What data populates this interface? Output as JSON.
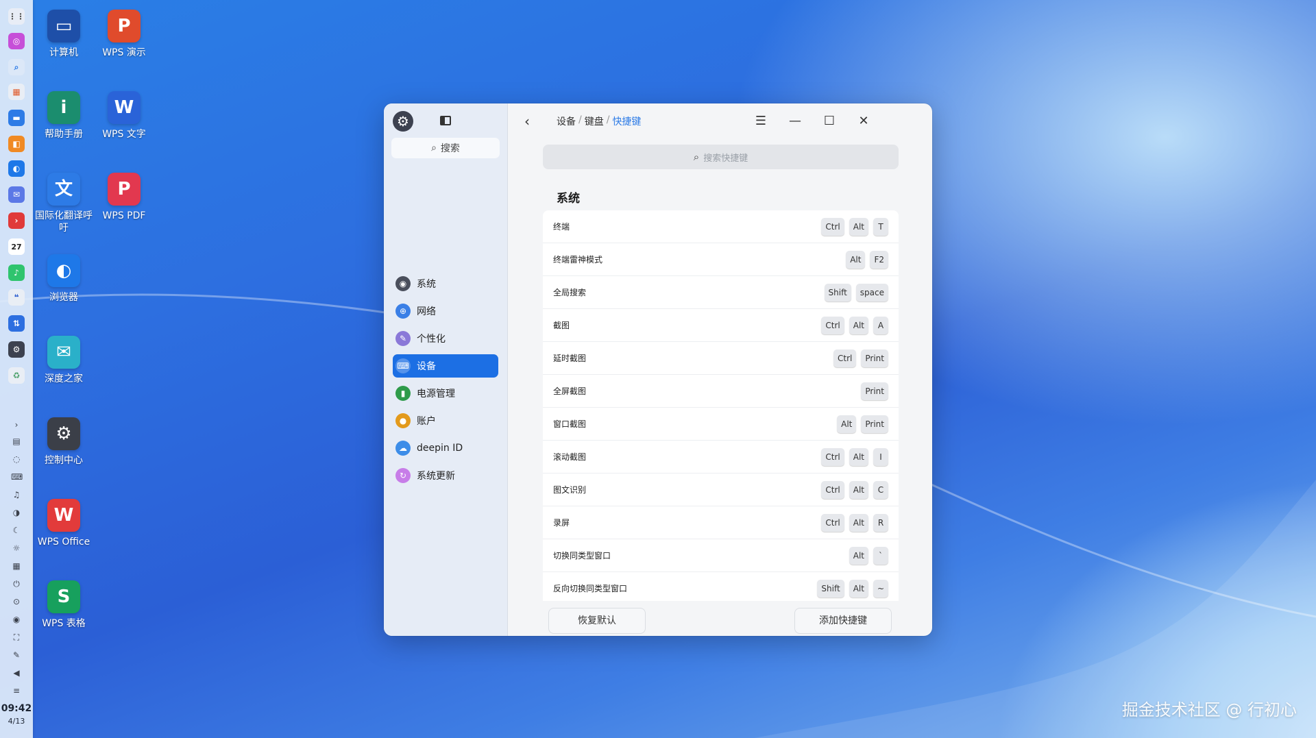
{
  "desktop": {
    "icons": [
      {
        "label": "计算机",
        "glyph": "▭",
        "icon": "computer-icon",
        "color": "#1e4fa8"
      },
      {
        "label": "WPS 演示",
        "glyph": "P",
        "icon": "wps-presentation-icon",
        "color": "#e04b2c"
      },
      {
        "label": "帮助手册",
        "glyph": "i",
        "icon": "help-manual-icon",
        "color": "#1b8d6e"
      },
      {
        "label": "WPS 文字",
        "glyph": "W",
        "icon": "wps-writer-icon",
        "color": "#2a63d8"
      },
      {
        "label": "国际化翻译呼吁",
        "glyph": "文",
        "icon": "translate-icon",
        "color": "#2d7be6"
      },
      {
        "label": "WPS PDF",
        "glyph": "P",
        "icon": "wps-pdf-icon",
        "color": "#e2384f"
      },
      {
        "label": "浏览器",
        "glyph": "◐",
        "icon": "browser-icon",
        "color": "#1e78e8"
      },
      {
        "label": "深度之家",
        "glyph": "✉",
        "icon": "deepin-home-icon",
        "color": "#2ab0c9"
      },
      {
        "label": "控制中心",
        "glyph": "⚙",
        "icon": "control-center-icon",
        "color": "#3b3f48"
      },
      {
        "label": "WPS Office",
        "glyph": "W",
        "icon": "wps-office-icon",
        "color": "#e23b3b"
      },
      {
        "label": "WPS 表格",
        "glyph": "S",
        "icon": "wps-spreadsheet-icon",
        "color": "#17a05d"
      }
    ]
  },
  "dock": {
    "time": "09:42",
    "date": "4/13",
    "calendar_day": "27"
  },
  "window": {
    "sidebar": {
      "search_label": "搜索",
      "items": [
        {
          "label": "系统",
          "icon": "system-icon",
          "color": "#4a4f5c",
          "glyph": "◉"
        },
        {
          "label": "网络",
          "icon": "network-icon",
          "color": "#3a7fe6",
          "glyph": "⊕"
        },
        {
          "label": "个性化",
          "icon": "personalization-icon",
          "color": "#8a78d8",
          "glyph": "✎"
        },
        {
          "label": "设备",
          "icon": "device-icon",
          "color": "#ffffff",
          "glyph": "⌨"
        },
        {
          "label": "电源管理",
          "icon": "power-icon",
          "color": "#2e9b4a",
          "glyph": "▮"
        },
        {
          "label": "账户",
          "icon": "account-icon",
          "color": "#e39a1c",
          "glyph": "●"
        },
        {
          "label": "deepin ID",
          "icon": "deepin-id-icon",
          "color": "#3d8de8",
          "glyph": "☁"
        },
        {
          "label": "系统更新",
          "icon": "system-update-icon",
          "color": "#c77de8",
          "glyph": "↻"
        }
      ],
      "active_index": 3
    },
    "breadcrumb": {
      "items": [
        "设备",
        "键盘",
        "快捷键"
      ]
    },
    "search_placeholder": "搜索快捷键",
    "section_title": "系统",
    "shortcuts": [
      {
        "name": "终端",
        "keys": [
          "Ctrl",
          "Alt",
          "T"
        ]
      },
      {
        "name": "终端雷神模式",
        "keys": [
          "Alt",
          "F2"
        ]
      },
      {
        "name": "全局搜索",
        "keys": [
          "Shift",
          "space"
        ]
      },
      {
        "name": "截图",
        "keys": [
          "Ctrl",
          "Alt",
          "A"
        ]
      },
      {
        "name": "延时截图",
        "keys": [
          "Ctrl",
          "Print"
        ]
      },
      {
        "name": "全屏截图",
        "keys": [
          "Print"
        ]
      },
      {
        "name": "窗口截图",
        "keys": [
          "Alt",
          "Print"
        ]
      },
      {
        "name": "滚动截图",
        "keys": [
          "Ctrl",
          "Alt",
          "I"
        ]
      },
      {
        "name": "图文识别",
        "keys": [
          "Ctrl",
          "Alt",
          "C"
        ]
      },
      {
        "name": "录屏",
        "keys": [
          "Ctrl",
          "Alt",
          "R"
        ]
      },
      {
        "name": "切换同类型窗口",
        "keys": [
          "Alt",
          "`"
        ]
      },
      {
        "name": "反向切换同类型窗口",
        "keys": [
          "Shift",
          "Alt",
          "~"
        ]
      }
    ],
    "footer": {
      "restore_label": "恢复默认",
      "add_label": "添加快捷键"
    }
  },
  "watermark": "掘金技术社区 @ 行初心"
}
